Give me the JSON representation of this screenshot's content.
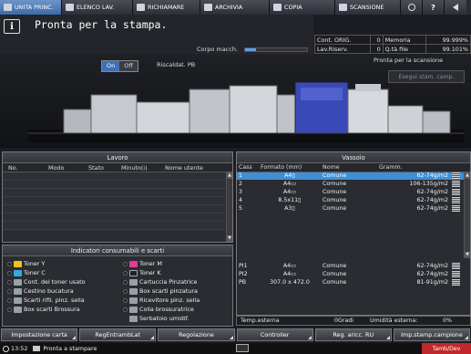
{
  "tabs": [
    {
      "label": "UNITA PRINC.",
      "icon": "home-icon",
      "active": true
    },
    {
      "label": "ELENCO LAV.",
      "icon": "job-list-icon",
      "active": false
    },
    {
      "label": "RICHIAMARE",
      "icon": "recall-icon",
      "active": false
    },
    {
      "label": "ARCHIVIA",
      "icon": "store-icon",
      "active": false
    },
    {
      "label": "COPIA",
      "icon": "copy-icon",
      "active": false
    },
    {
      "label": "SCANSIONE",
      "icon": "scan-icon",
      "active": false
    }
  ],
  "header": {
    "message": "Pronta per la stampa.",
    "corpo_label": "Corpo macch.",
    "corpo_level": 0.18
  },
  "counters": {
    "cont_orig_label": "Cont. ORIG.",
    "cont_orig_value": "0",
    "memoria_label": "Memoria",
    "memoria_value": "99.999%",
    "lav_riserv_label": "Lav.Riserv.",
    "lav_riserv_value": "0",
    "q_file_label": "Q.tà file",
    "q_file_value": "99.101%"
  },
  "machine": {
    "on_label": "On",
    "off_label": "Off",
    "riscald_label": "Riscaldat. PB",
    "scan_ready": "Pronta per la scansione",
    "esegui_label": "Esegui stam. camp."
  },
  "lavoro": {
    "title": "Lavoro",
    "columns": [
      "No.",
      "Modo",
      "Stato",
      "Minuto(i)",
      "Nome utente"
    ]
  },
  "consumabili": {
    "title": "Indicatori consumabili e scarti",
    "left": [
      "Toner Y",
      "Toner C",
      "Cont. del toner usato",
      "Cestino bucatura",
      "Scarti rifil. pinz. sella",
      "Box scarti Brossura"
    ],
    "right": [
      "Toner M",
      "Toner K",
      "Cartuccia Pinzatrice",
      "Box scarti pinzatura",
      "Ricevitore pinz. sella",
      "Colla brossuratrice",
      "Serbatoio umidif."
    ]
  },
  "vassoio": {
    "title": "Vassoio",
    "columns": [
      "Cass",
      "Formato (mm)",
      "Nome",
      "Gramm."
    ],
    "rows": [
      {
        "cass": "1",
        "formato": "A4▯",
        "nome": "Comune",
        "gramm": "62-74g/m2",
        "selected": true
      },
      {
        "cass": "2",
        "formato": "A4▭",
        "nome": "Comune",
        "gramm": "106-135g/m2",
        "selected": false
      },
      {
        "cass": "3",
        "formato": "A4▭",
        "nome": "Comune",
        "gramm": "62-74g/m2",
        "selected": false
      },
      {
        "cass": "4",
        "formato": "8.5x11▯",
        "nome": "Comune",
        "gramm": "62-74g/m2",
        "selected": false
      },
      {
        "cass": "5",
        "formato": "A3▯",
        "nome": "Comune",
        "gramm": "62-74g/m2",
        "selected": false
      }
    ],
    "bottom_rows": [
      {
        "cass": "PI1",
        "formato": "A4▭",
        "nome": "Comune",
        "gramm": "62-74g/m2"
      },
      {
        "cass": "PI2",
        "formato": "A4▭",
        "nome": "Comune",
        "gramm": "62-74g/m2"
      },
      {
        "cass": "PB",
        "formato": "307.0 x 472.0",
        "nome": "Comune",
        "gramm": "81-91g/m2"
      }
    ]
  },
  "env": {
    "temp_label": "Temp.esterna",
    "temp_value": "0Gradi",
    "hum_label": "Umidità esterna:",
    "hum_value": "0%"
  },
  "bottom_buttons": [
    "Impostazione carta",
    "RegEntrambLat",
    "Regolazione",
    "Controller",
    "Reg. aricc. RU",
    "Imp.stamp.campione"
  ],
  "status": {
    "time": "13:52",
    "message": "Pronta a stampare",
    "tamb": "Tamb/Dev"
  },
  "colors": {
    "accent": "#3d71b8",
    "selected_row": "#3f8fd6",
    "toner_y": "#f0c419",
    "toner_m": "#e23b8f",
    "toner_c": "#32a9e0",
    "toner_k": "#222222",
    "tamb": "#c0282b"
  }
}
